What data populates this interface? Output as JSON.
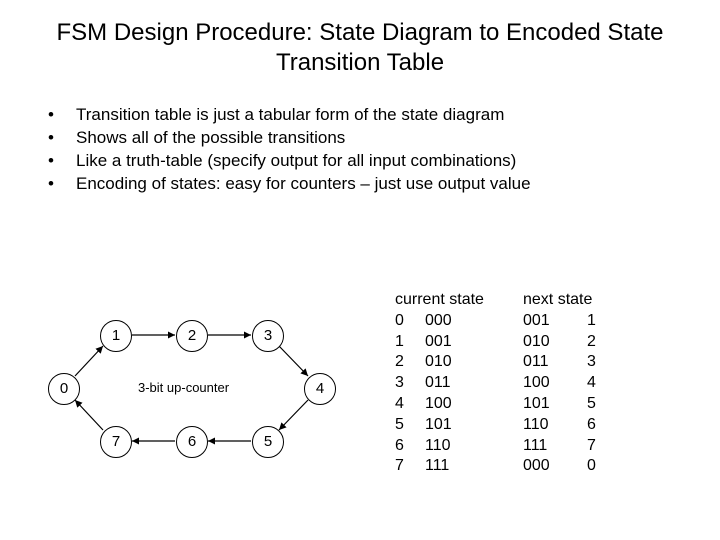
{
  "title": "FSM Design Procedure: State Diagram to Encoded State Transition Table",
  "bullets": [
    "Transition table is just a tabular form of the state diagram",
    "Shows all of the possible transitions",
    "Like a truth-table (specify output for all input combinations)",
    "Encoding of states: easy for counters – just use output value"
  ],
  "bullet_glyph": "•",
  "diagram": {
    "caption": "3-bit up-counter",
    "states": [
      "0",
      "1",
      "2",
      "3",
      "4",
      "5",
      "6",
      "7"
    ]
  },
  "table": {
    "header_current": "current state",
    "header_next": "next state",
    "rows": [
      {
        "dec": "0",
        "bin": "000",
        "nxbin": "001",
        "nxdec": "1"
      },
      {
        "dec": "1",
        "bin": "001",
        "nxbin": "010",
        "nxdec": "2"
      },
      {
        "dec": "2",
        "bin": "010",
        "nxbin": "011",
        "nxdec": "3"
      },
      {
        "dec": "3",
        "bin": "011",
        "nxbin": "100",
        "nxdec": "4"
      },
      {
        "dec": "4",
        "bin": "100",
        "nxbin": "101",
        "nxdec": "5"
      },
      {
        "dec": "5",
        "bin": "101",
        "nxbin": "110",
        "nxdec": "6"
      },
      {
        "dec": "6",
        "bin": "110",
        "nxbin": "111",
        "nxdec": "7"
      },
      {
        "dec": "7",
        "bin": "111",
        "nxbin": "000",
        "nxdec": "0"
      }
    ]
  }
}
